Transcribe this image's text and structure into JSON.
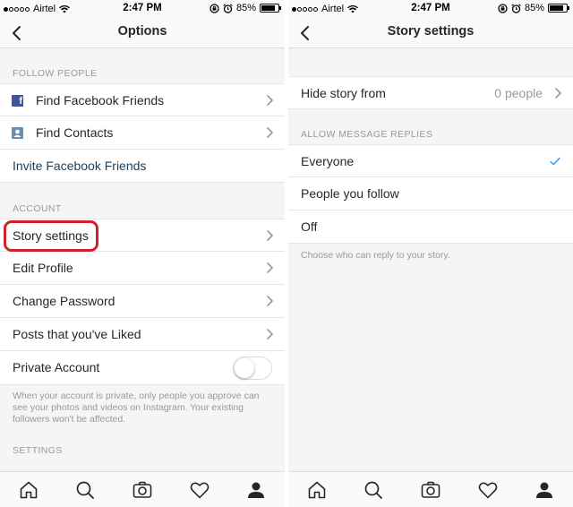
{
  "status_bar": {
    "carrier": "Airtel",
    "time": "2:47 PM",
    "battery": "85%",
    "battery_level": 0.85,
    "signal_bars_filled": 1,
    "signal_bars_total": 5
  },
  "options_screen": {
    "title": "Options",
    "follow_people_header": "FOLLOW PEOPLE",
    "find_facebook_friends": "Find Facebook Friends",
    "find_contacts": "Find Contacts",
    "invite_facebook_friends": "Invite Facebook Friends",
    "account_header": "ACCOUNT",
    "story_settings": "Story settings",
    "edit_profile": "Edit Profile",
    "change_password": "Change Password",
    "posts_liked": "Posts that you've Liked",
    "private_account": "Private Account",
    "private_account_enabled": false,
    "private_note": "When your account is private, only people you approve can see your photos and videos on Instagram. Your existing followers won't be affected.",
    "settings_header": "SETTINGS"
  },
  "story_screen": {
    "title": "Story settings",
    "hide_story_from": "Hide story from",
    "hide_story_count": "0 people",
    "allow_replies_header": "ALLOW MESSAGE REPLIES",
    "options": [
      "Everyone",
      "People you follow",
      "Off"
    ],
    "selected_option": "Everyone",
    "note": "Choose who can reply to your story."
  },
  "tabs": [
    "home-icon",
    "search-icon",
    "camera-icon",
    "heart-icon",
    "profile-icon"
  ],
  "colors": {
    "accent_check": "#3897f0",
    "highlight": "#d0202a",
    "link": "#173f5f",
    "facebook": "#3b5998"
  }
}
